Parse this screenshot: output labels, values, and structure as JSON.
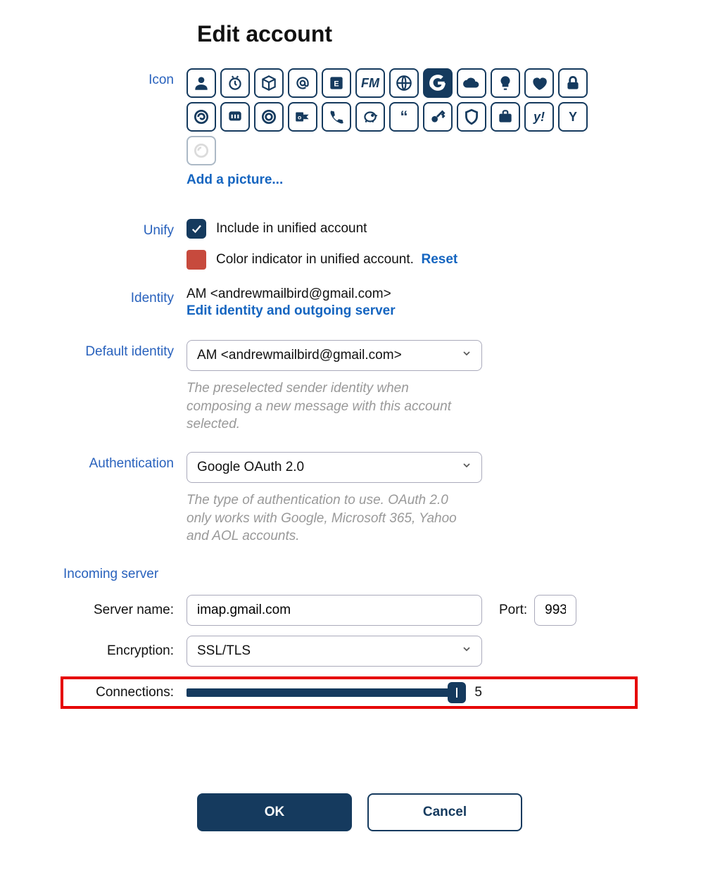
{
  "title": "Edit account",
  "labels": {
    "icon": "Icon",
    "unify": "Unify",
    "identity": "Identity",
    "default_identity": "Default identity",
    "authentication": "Authentication",
    "incoming_server": "Incoming server",
    "server_name": "Server name:",
    "port": "Port:",
    "encryption": "Encryption:",
    "connections": "Connections:"
  },
  "icon_picker": {
    "add_picture": "Add a picture...",
    "selected_index": 8
  },
  "unify": {
    "include_label": "Include in unified account",
    "checked": true,
    "color": "#c74a3d",
    "color_label": "Color indicator in unified account.",
    "reset": "Reset"
  },
  "identity": {
    "text": "AM <andrewmailbird@gmail.com>",
    "edit_link": "Edit identity and outgoing server"
  },
  "default_identity": {
    "selected": "AM <andrewmailbird@gmail.com>",
    "helper": "The preselected sender identity when composing a new message with this account selected."
  },
  "authentication": {
    "selected": "Google OAuth 2.0",
    "helper": "The type of authentication to use. OAuth 2.0 only works with Google, Microsoft 365, Yahoo and AOL accounts."
  },
  "incoming": {
    "server_name": "imap.gmail.com",
    "port": "993",
    "encryption": "SSL/TLS",
    "connections": "5"
  },
  "buttons": {
    "ok": "OK",
    "cancel": "Cancel"
  }
}
